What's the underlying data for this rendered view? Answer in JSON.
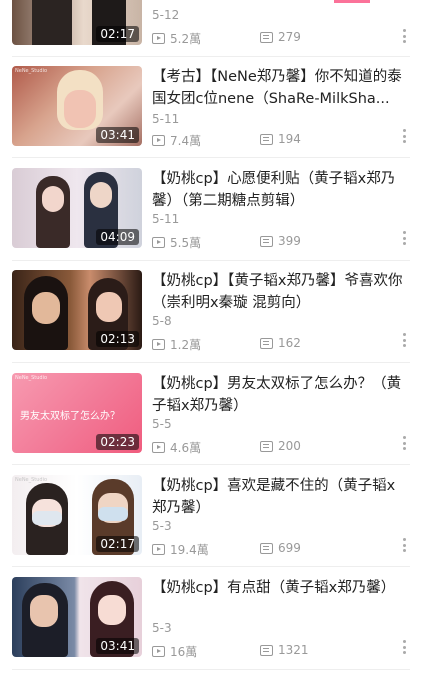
{
  "videos": [
    {
      "title": "",
      "date": "5-12",
      "duration": "02:17",
      "views": "5.2萬",
      "danmaku": "279",
      "thumb_text": ""
    },
    {
      "title": "【考古】【NeNe郑乃馨】你不知道的泰国女团c位nene（ShaRe-MilkSha...",
      "date": "5-11",
      "duration": "03:41",
      "views": "7.4萬",
      "danmaku": "194",
      "thumb_text": ""
    },
    {
      "title": "【奶桃cp】心愿便利贴（黄子韬x郑乃馨）（第二期糖点剪辑）",
      "date": "5-11",
      "duration": "04:09",
      "views": "5.5萬",
      "danmaku": "399",
      "thumb_text": ""
    },
    {
      "title": "【奶桃cp】【黄子韬x郑乃馨】爷喜欢你（崇利明x秦璇 混剪向）",
      "date": "5-8",
      "duration": "02:13",
      "views": "1.2萬",
      "danmaku": "162",
      "thumb_text": ""
    },
    {
      "title": "【奶桃cp】男友太双标了怎么办？（黄子韬x郑乃馨）",
      "date": "5-5",
      "duration": "02:23",
      "views": "4.6萬",
      "danmaku": "200",
      "thumb_text": "男友太双标了怎么办？"
    },
    {
      "title": "【奶桃cp】喜欢是藏不住的（黄子韬x郑乃馨）",
      "date": "5-3",
      "duration": "02:17",
      "views": "19.4萬",
      "danmaku": "699",
      "thumb_text": ""
    },
    {
      "title": "【奶桃cp】有点甜（黄子韬x郑乃馨）",
      "date": "5-3",
      "duration": "03:41",
      "views": "16萬",
      "danmaku": "1321",
      "thumb_text": ""
    }
  ],
  "colors": {
    "accent": "#fb7299",
    "meta": "#999999"
  }
}
